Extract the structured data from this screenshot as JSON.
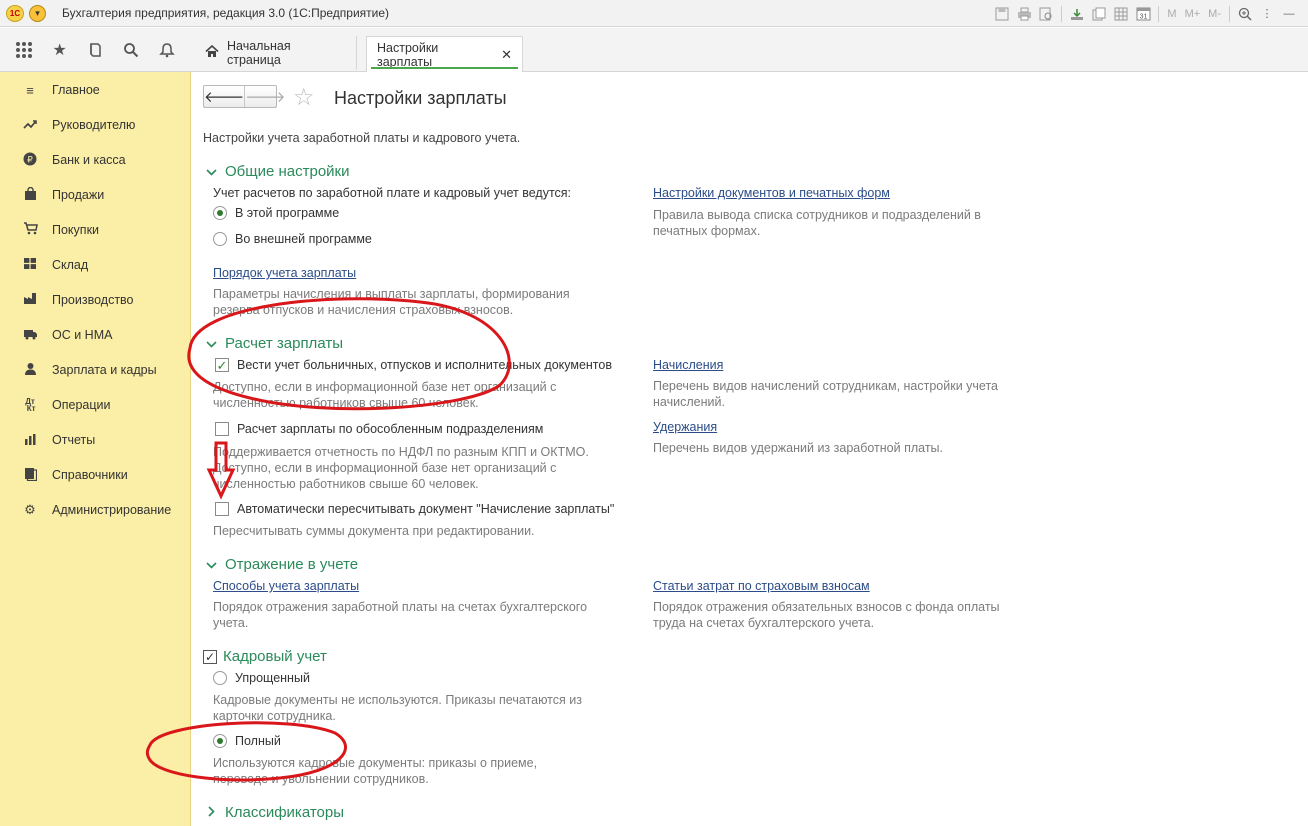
{
  "titlebar": {
    "logo": "1С",
    "app_title": "Бухгалтерия предприятия, редакция 3.0  (1С:Предприятие)",
    "icons": [
      "save-icon",
      "print-icon",
      "preview-icon",
      "attach-icon",
      "copy-icon",
      "table-icon",
      "calendar-icon"
    ],
    "calendar_day": "31",
    "mem_labels": [
      "M",
      "M+",
      "M-"
    ]
  },
  "tabs": {
    "home_label": "Начальная страница",
    "active_label": "Настройки зарплаты",
    "close_glyph": "✕"
  },
  "sidebar": {
    "items": [
      {
        "label": "Главное",
        "icon": "menu-lines-icon"
      },
      {
        "label": "Руководителю",
        "icon": "trend-icon"
      },
      {
        "label": "Банк и касса",
        "icon": "ruble-icon"
      },
      {
        "label": "Продажи",
        "icon": "bag-icon"
      },
      {
        "label": "Покупки",
        "icon": "cart-icon"
      },
      {
        "label": "Склад",
        "icon": "warehouse-icon"
      },
      {
        "label": "Производство",
        "icon": "factory-icon"
      },
      {
        "label": "ОС и НМА",
        "icon": "assets-icon"
      },
      {
        "label": "Зарплата и кадры",
        "icon": "person-icon"
      },
      {
        "label": "Операции",
        "icon": "dt-kt-icon"
      },
      {
        "label": "Отчеты",
        "icon": "report-icon"
      },
      {
        "label": "Справочники",
        "icon": "book-icon"
      },
      {
        "label": "Администрирование",
        "icon": "gear-icon"
      }
    ]
  },
  "page": {
    "title": "Настройки зарплаты",
    "description": "Настройки учета заработной платы и кадрового учета."
  },
  "general": {
    "title": "Общие настройки",
    "question": "Учет расчетов по заработной плате и кадровый учет ведутся:",
    "radio_in": "В этой программе",
    "radio_out": "Во внешней программе",
    "order_link": "Порядок учета зарплаты",
    "order_hint_1": "Параметры начисления и выплаты зарплаты, формирования",
    "order_hint_2": "резерва отпусков и начисления страховых взносов.",
    "docs_link": "Настройки документов и печатных форм",
    "docs_hint_1": "Правила вывода списка сотрудников и подразделений в",
    "docs_hint_2": "печатных формах."
  },
  "calc": {
    "title": "Расчет зарплаты",
    "check1": "Вести учет больничных, отпусков и исполнительных документов",
    "check1_hint_1": "Доступно, если в информационной базе нет организаций с",
    "check1_hint_2": "численностью работников свыше 60 человек.",
    "check2": "Расчет зарплаты по обособленным подразделениям",
    "check2_hint_1": "Поддерживается отчетность по НДФЛ по разным КПП и ОКТМО.",
    "check2_hint_2": "Доступно, если в информационной базе нет организаций с",
    "check2_hint_3": "численностью работников свыше 60 человек.",
    "check3": "Автоматически пересчитывать документ \"Начисление зарплаты\"",
    "check3_hint": "Пересчитывать суммы документа при редактировании.",
    "accruals_link": "Начисления",
    "accruals_hint_1": "Перечень видов начислений сотрудникам, настройки учета",
    "accruals_hint_2": "начислений.",
    "deductions_link": "Удержания",
    "deductions_hint": "Перечень видов удержаний из заработной платы."
  },
  "accounting": {
    "title": "Отражение в учете",
    "methods_link": "Способы учета зарплаты",
    "methods_hint_1": "Порядок отражения заработной платы на счетах бухгалтерского",
    "methods_hint_2": "учета.",
    "costs_link": "Статьи затрат по страховым взносам",
    "costs_hint_1": "Порядок отражения обязательных взносов с фонда оплаты",
    "costs_hint_2": "труда на счетах бухгалтерского учета."
  },
  "hr": {
    "title": "Кадровый учет",
    "simple": "Упрощенный",
    "simple_hint_1": "Кадровые документы не используются. Приказы печатаются из",
    "simple_hint_2": "карточки сотрудника.",
    "full": "Полный",
    "full_hint_1": "Используются кадровые документы: приказы о приеме,",
    "full_hint_2": "переводе и увольнении сотрудников."
  },
  "classifiers": {
    "title": "Классификаторы"
  },
  "annotation_color": "#d9171b"
}
